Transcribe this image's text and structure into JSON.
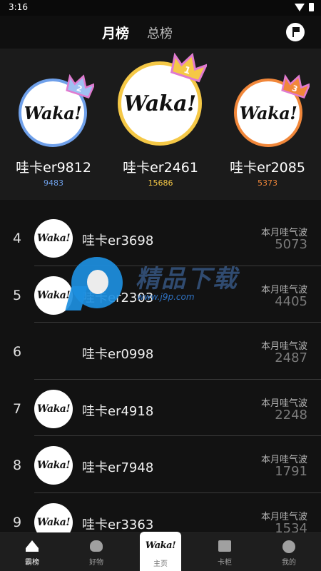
{
  "status": {
    "time": "3:16"
  },
  "header": {
    "tabs": [
      "月榜",
      "总榜"
    ]
  },
  "logo_text": "Waka!",
  "podium": [
    {
      "rank": "2",
      "name": "哇卡er9812",
      "score": "9483",
      "color": "#6fa0ea"
    },
    {
      "rank": "1",
      "name": "哇卡er2461",
      "score": "15686",
      "color": "#f5c846"
    },
    {
      "rank": "3",
      "name": "哇卡er2085",
      "score": "5373",
      "color": "#f1873a"
    }
  ],
  "list_label": "本月哇气波",
  "list": [
    {
      "rank": "4",
      "name": "哇卡er3698",
      "value": "5073"
    },
    {
      "rank": "5",
      "name": "哇卡er2303",
      "value": "4405"
    },
    {
      "rank": "6",
      "name": "哇卡er0998",
      "value": "2487"
    },
    {
      "rank": "7",
      "name": "哇卡er4918",
      "value": "2248"
    },
    {
      "rank": "8",
      "name": "哇卡er7948",
      "value": "1791"
    },
    {
      "rank": "9",
      "name": "哇卡er3363",
      "value": "1534"
    }
  ],
  "watermark": {
    "text": "精品下载",
    "url": "www.j9p.com"
  },
  "nav": [
    {
      "label": "霸榜",
      "icon": "crown-icon"
    },
    {
      "label": "好物",
      "icon": "mask-icon"
    },
    {
      "label": "主页",
      "icon": "waka-logo"
    },
    {
      "label": "卡柜",
      "icon": "store-icon"
    },
    {
      "label": "我的",
      "icon": "user-icon"
    }
  ]
}
